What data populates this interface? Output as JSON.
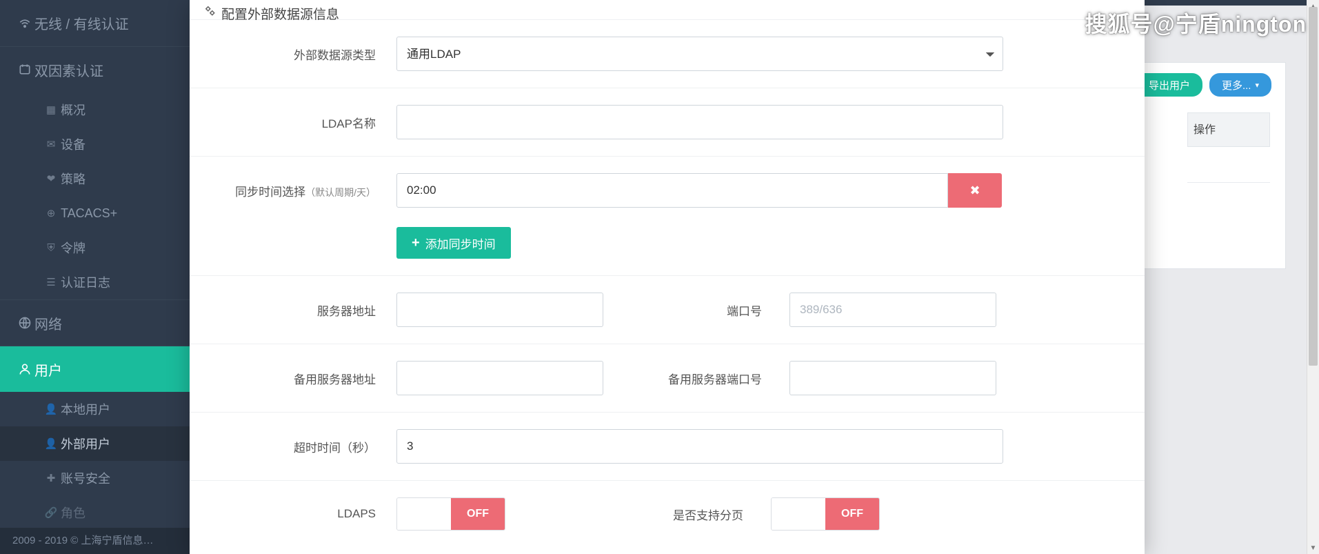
{
  "watermark": "搜狐号@宁盾nington",
  "footer": "2009 - 2019 © 上海宁盾信息…",
  "sidebar": {
    "items": [
      {
        "label": "无线 / 有线认证",
        "icon": "wifi-icon"
      },
      {
        "label": "双因素认证",
        "icon": "badge-icon"
      }
    ],
    "twofa_sub": [
      {
        "label": "概况",
        "icon": "grid-icon"
      },
      {
        "label": "设备",
        "icon": "mail-icon"
      },
      {
        "label": "策略",
        "icon": "tag-icon"
      },
      {
        "label": "TACACS+",
        "icon": "globe-icon"
      },
      {
        "label": "令牌",
        "icon": "shield-icon"
      },
      {
        "label": "认证日志",
        "icon": "list-icon"
      }
    ],
    "after": [
      {
        "label": "网络",
        "icon": "globe-icon"
      },
      {
        "label": "用户",
        "icon": "user-icon",
        "active": true
      }
    ],
    "user_sub": [
      {
        "label": "本地用户",
        "icon": "user-icon"
      },
      {
        "label": "外部用户",
        "icon": "user-icon",
        "active": true
      },
      {
        "label": "账号安全",
        "icon": "puzzle-icon"
      },
      {
        "label": "角色",
        "icon": "link-icon"
      }
    ]
  },
  "bg": {
    "export_btn": "导出用户",
    "more_btn": "更多...",
    "th_action": "操作"
  },
  "modal": {
    "title": "配置外部数据源信息",
    "labels": {
      "type": "外部数据源类型",
      "ldap_name": "LDAP名称",
      "sync": "同步时间选择",
      "sync_hint": "（默认周期/天）",
      "add_sync": "添加同步时间",
      "server": "服务器地址",
      "port": "端口号",
      "port_ph": "389/636",
      "bserver": "备用服务器地址",
      "bport": "备用服务器端口号",
      "timeout": "超时时间（秒）",
      "ldaps": "LDAPS",
      "paging": "是否支持分页"
    },
    "values": {
      "type": "通用LDAP",
      "ldap_name": "",
      "sync_time": "02:00",
      "server": "",
      "port": "",
      "bserver": "",
      "bport": "",
      "timeout": "3",
      "ldaps": "OFF",
      "paging": "OFF"
    }
  }
}
